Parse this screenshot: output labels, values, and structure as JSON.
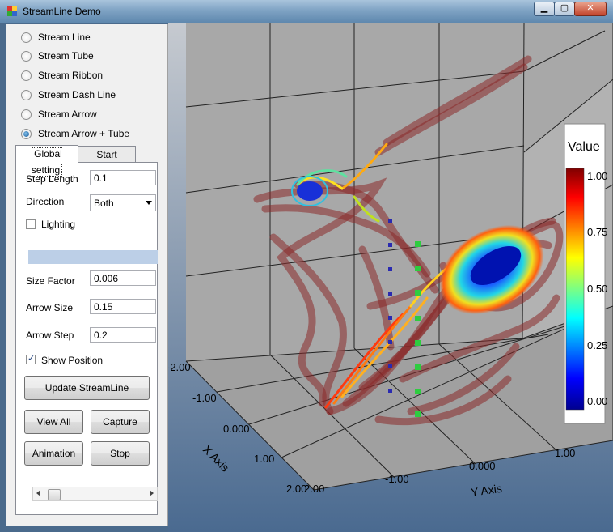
{
  "window": {
    "title": "StreamLine Demo"
  },
  "caption_buttons": {
    "minimize": "▁",
    "maximize": "▢",
    "close": "✕"
  },
  "modes": [
    {
      "label": "Stream Line",
      "checked": false
    },
    {
      "label": "Stream Tube",
      "checked": false
    },
    {
      "label": "Stream Ribbon",
      "checked": false
    },
    {
      "label": "Stream Dash Line",
      "checked": false
    },
    {
      "label": "Stream Arrow",
      "checked": false
    },
    {
      "label": "Stream Arrow + Tube",
      "checked": true
    }
  ],
  "tabs": {
    "global": "Global setting",
    "start": "Start Position"
  },
  "settings": {
    "step_length_label": "Step Length",
    "step_length": "0.1",
    "direction_label": "Direction",
    "direction": "Both",
    "lighting_label": "Lighting",
    "lighting": false,
    "size_factor_label": "Size Factor",
    "size_factor": "0.006",
    "arrow_size_label": "Arrow Size",
    "arrow_size": "0.15",
    "arrow_step_label": "Arrow Step",
    "arrow_step": "0.2",
    "show_position_label": "Show Position",
    "show_position": true
  },
  "buttons": {
    "update": "Update StreamLine",
    "view_all": "View All",
    "capture": "Capture",
    "animation": "Animation",
    "stop": "Stop"
  },
  "plot": {
    "x_axis_title": "X Axis",
    "y_axis_title": "Y Axis",
    "x_ticks": [
      "-2.00",
      "-1.00",
      "0.000",
      "1.00",
      "2.00"
    ],
    "y_ticks": [
      "2.00",
      "-1.00",
      "0.000",
      "1.00"
    ],
    "legend": {
      "title": "Value",
      "ticks": [
        "1.00",
        "0.75",
        "0.50",
        "0.25",
        "0.00"
      ]
    },
    "colors": {
      "background": "#aaaaaa",
      "tube": "#8b2a2a",
      "seed": "#2a2ab0",
      "seed_green": "#2ecc40"
    }
  }
}
